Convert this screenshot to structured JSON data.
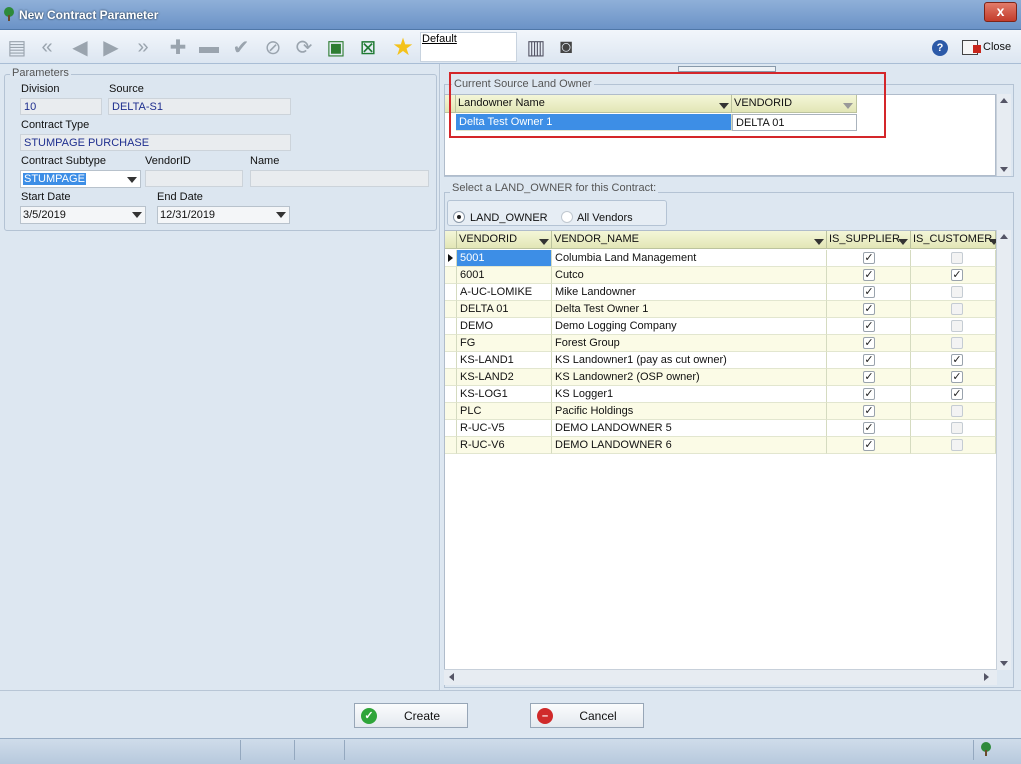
{
  "window": {
    "title": "New Contract Parameter",
    "close_glyph": "x"
  },
  "toolbar": {
    "icons": [
      "print-icon",
      "first-icon",
      "prev-icon",
      "next-icon",
      "last-icon",
      "add-icon",
      "remove-icon",
      "post-icon",
      "cancel-edit-icon",
      "refresh-icon",
      "export-icon",
      "excel-icon"
    ],
    "layout_name": "Default",
    "help_glyph": "?",
    "close_label": "Close"
  },
  "params": {
    "title": "Parameters",
    "division_label": "Division",
    "division_value": "10",
    "source_label": "Source",
    "source_value": "DELTA-S1",
    "contract_type_label": "Contract Type",
    "contract_type_value": "STUMPAGE PURCHASE",
    "subtype_label": "Contract Subtype",
    "subtype_value": "STUMPAGE",
    "vendorid_label": "VendorID",
    "vendorid_value": "",
    "name_label": "Name",
    "name_value": "",
    "start_label": "Start Date",
    "start_value": "3/5/2019",
    "end_label": "End Date",
    "end_value": "12/31/2019"
  },
  "current_owner": {
    "title": "Current Source Land Owner",
    "col_name": "Landowner Name",
    "col_vendor": "VENDORID",
    "row_name": "Delta Test Owner 1",
    "row_vendor": "DELTA 01"
  },
  "select_owner": {
    "title": "Select a LAND_OWNER for this Contract:",
    "radio_land_owner": "LAND_OWNER",
    "radio_all_vendors": "All Vendors",
    "columns": [
      "VENDORID",
      "VENDOR_NAME",
      "IS_SUPPLIER",
      "IS_CUSTOMER"
    ],
    "rows": [
      {
        "id": "5001",
        "name": "Columbia Land Management",
        "supplier": true,
        "customer": false
      },
      {
        "id": "6001",
        "name": "Cutco",
        "supplier": true,
        "customer": true
      },
      {
        "id": "A-UC-LOMIKE",
        "name": "Mike Landowner",
        "supplier": true,
        "customer": false
      },
      {
        "id": "DELTA 01",
        "name": "Delta Test Owner 1",
        "supplier": true,
        "customer": false
      },
      {
        "id": "DEMO",
        "name": "Demo Logging Company",
        "supplier": true,
        "customer": false
      },
      {
        "id": "FG",
        "name": "Forest Group",
        "supplier": true,
        "customer": false
      },
      {
        "id": "KS-LAND1",
        "name": "KS Landowner1 (pay as cut owner)",
        "supplier": true,
        "customer": true
      },
      {
        "id": "KS-LAND2",
        "name": "KS Landowner2 (OSP owner)",
        "supplier": true,
        "customer": true
      },
      {
        "id": "KS-LOG1",
        "name": "KS Logger1",
        "supplier": true,
        "customer": true
      },
      {
        "id": "PLC",
        "name": "Pacific Holdings",
        "supplier": true,
        "customer": false
      },
      {
        "id": "R-UC-V5",
        "name": "DEMO LANDOWNER 5",
        "supplier": true,
        "customer": false
      },
      {
        "id": "R-UC-V6",
        "name": "DEMO LANDOWNER 6",
        "supplier": true,
        "customer": false
      }
    ]
  },
  "buttons": {
    "create": "Create",
    "cancel": "Cancel"
  },
  "colors": {
    "selection": "#3d8ee6",
    "header": "#e9ecc6",
    "alt_row": "#fbfbe6",
    "highlight_border": "#d4262a"
  }
}
